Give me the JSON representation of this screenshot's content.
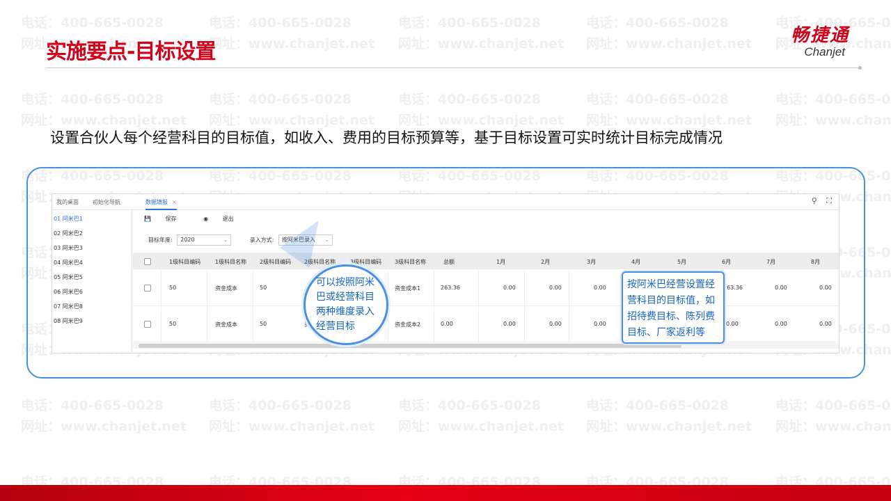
{
  "watermark": {
    "phone": "电话：400-665-0028",
    "site": "网址：www.chanjet.net"
  },
  "page": {
    "title": "实施要点-目标设置",
    "description": "设置合伙人每个经营科目的目标值，如收入、费用的目标预算等，基于目标设置可实时统计目标完成情况"
  },
  "logo": {
    "cn": "畅捷通",
    "en": "Chanjet"
  },
  "app": {
    "tabs": [
      {
        "label": "我的桌面"
      },
      {
        "label": "初始化导航"
      },
      {
        "label": "数据填报",
        "close": "×"
      }
    ],
    "top_icons": [
      "search-icon",
      "fullscreen-icon"
    ],
    "left_nav": [
      "01 阿米巴1",
      "02 阿米巴2",
      "03 阿米巴3",
      "04 阿米巴4",
      "05 阿米巴5",
      "06 阿米巴6",
      "07 阿米巴8",
      "08 阿米巴9"
    ],
    "toolbar": {
      "save": "保存",
      "exit": "退出"
    },
    "filters": {
      "year_label": "目标年度:",
      "year_value": "2020",
      "mode_label": "录入方式:",
      "mode_value": "按阿米巴录入"
    },
    "columns": [
      "1级科目编码",
      "1级科目名称",
      "2级科目编码",
      "2级科目名称",
      "3级科目编码",
      "3级科目名称",
      "总额",
      "1月",
      "2月",
      "3月",
      "4月",
      "5月",
      "6月",
      "7月",
      "8月"
    ],
    "rows": [
      {
        "c1": "50",
        "c2": "资金成本",
        "c3": "50",
        "c6": "资金成本1",
        "total": "263.36",
        "m1": "0.00",
        "m2": "0.00",
        "m3": "0.00",
        "m6": "263.36",
        "m7": "0.00",
        "m8": "0.00"
      },
      {
        "c1": "50",
        "c2": "资金成本",
        "c3": "50",
        "c4": "资",
        "c6": "资金成本2",
        "total": "0.00",
        "m1": "0.00",
        "m2": "0.00",
        "m3": "0.00",
        "m6": "0.00",
        "m7": "0.00",
        "m8": "0.00"
      }
    ]
  },
  "callouts": {
    "left": "可以按照阿米巴或经营科目两种维度录入经营目标",
    "right": "按阿米巴经营设置经营科目的目标值，如招待费目标、陈列费目标、厂家返利等"
  },
  "colors": {
    "brand_red": "#d0021b",
    "accent_blue": "#4a90e2",
    "footer_red": "#e60012"
  }
}
